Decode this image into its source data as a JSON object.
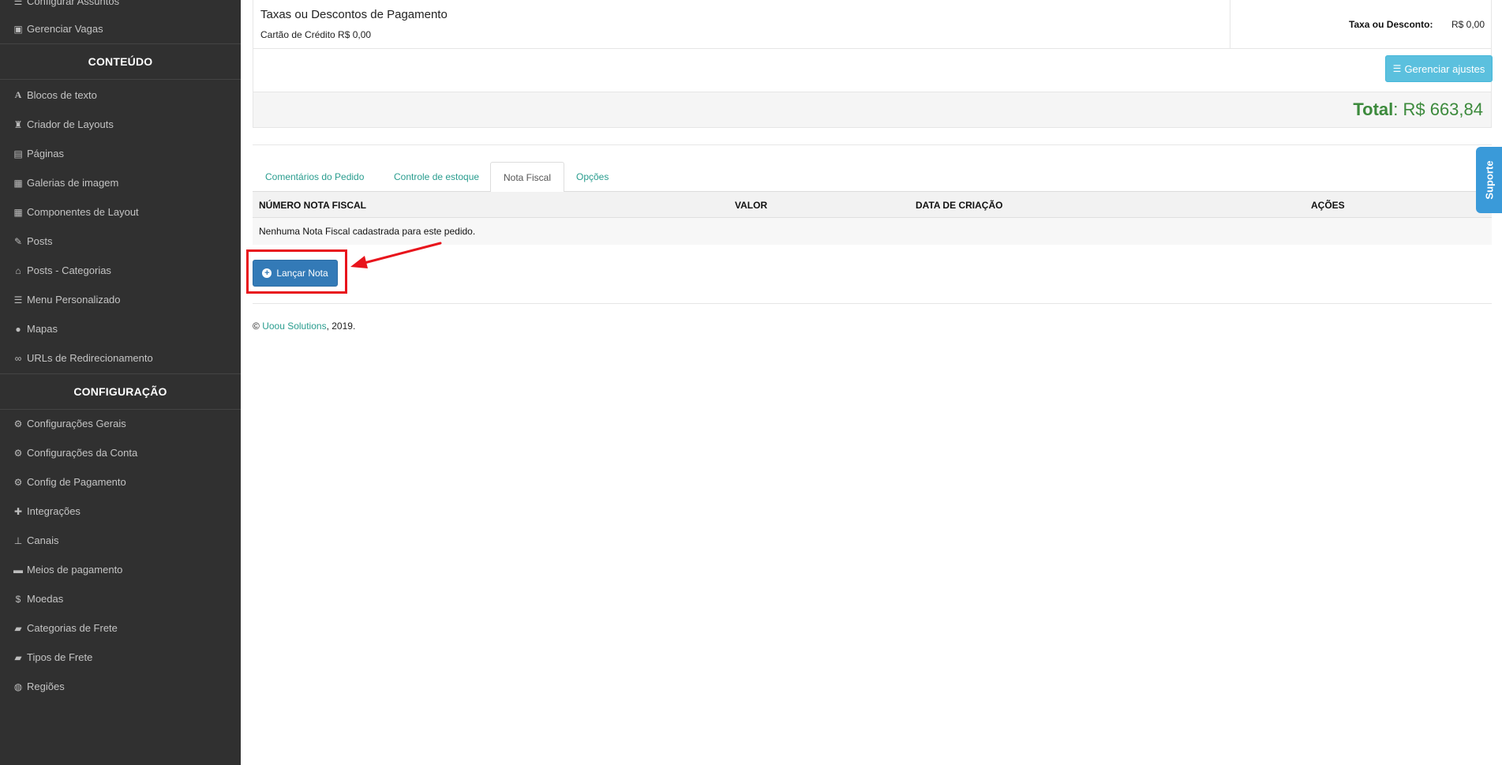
{
  "sidebar": {
    "top_items": [
      {
        "icon": "list-icon",
        "label": "Configurar Assuntos"
      },
      {
        "icon": "briefcase-icon",
        "label": "Gerenciar Vagas"
      }
    ],
    "sections": [
      {
        "heading": "CONTEÚDO",
        "items": [
          {
            "icon": "font-icon",
            "label": "Blocos de texto"
          },
          {
            "icon": "chess-rook-icon",
            "label": "Criador de Layouts"
          },
          {
            "icon": "file-icon",
            "label": "Páginas"
          },
          {
            "icon": "film-icon",
            "label": "Galerias de imagem"
          },
          {
            "icon": "th-large-icon",
            "label": "Componentes de Layout"
          },
          {
            "icon": "pin-icon",
            "label": "Posts"
          },
          {
            "icon": "home-icon",
            "label": "Posts - Categorias"
          },
          {
            "icon": "list-icon",
            "label": "Menu Personalizado"
          },
          {
            "icon": "map-marker-icon",
            "label": "Mapas"
          },
          {
            "icon": "link-icon",
            "label": "URLs de Redirecionamento"
          }
        ]
      },
      {
        "heading": "CONFIGURAÇÃO",
        "items": [
          {
            "icon": "gear-icon",
            "label": "Configurações Gerais"
          },
          {
            "icon": "gear-icon",
            "label": "Configurações da Conta"
          },
          {
            "icon": "gear-icon",
            "label": "Config de Pagamento"
          },
          {
            "icon": "puzzle-icon",
            "label": "Integrações"
          },
          {
            "icon": "sitemap-icon",
            "label": "Canais"
          },
          {
            "icon": "credit-card-icon",
            "label": "Meios de pagamento"
          },
          {
            "icon": "dollar-icon",
            "label": "Moedas"
          },
          {
            "icon": "truck-icon",
            "label": "Categorias de Frete"
          },
          {
            "icon": "truck-icon",
            "label": "Tipos de Frete"
          },
          {
            "icon": "globe-icon",
            "label": "Regiões"
          }
        ]
      }
    ]
  },
  "fees": {
    "title": "Taxas ou Descontos de Pagamento",
    "subtitle": "Cartão de Crédito R$ 0,00",
    "right_label": "Taxa ou Desconto:",
    "right_value": "R$ 0,00",
    "manage_button": "Gerenciar ajustes"
  },
  "total": {
    "label": "Total",
    "value": ": R$ 663,84"
  },
  "tabs": [
    {
      "label": "Comentários do Pedido",
      "active": false
    },
    {
      "label": "Controle de estoque",
      "active": false
    },
    {
      "label": "Nota Fiscal",
      "active": true
    },
    {
      "label": "Opções",
      "active": false
    }
  ],
  "invoice_table": {
    "columns": [
      "NÚMERO NOTA FISCAL",
      "VALOR",
      "DATA DE CRIAÇÃO",
      "AÇÕES"
    ],
    "empty_message": "Nenhuma Nota Fiscal cadastrada para este pedido."
  },
  "launch_button": "Lançar Nota",
  "footer": {
    "copyright": "©",
    "company": "Uoou Solutions",
    "year": ", 2019."
  },
  "support_tab": "Suporte",
  "colors": {
    "sidebar_bg": "#303030",
    "accent_teal": "#2a9d8f",
    "info_button": "#5bc0de",
    "primary_button": "#337ab7",
    "total_green": "#3c8a3c",
    "highlight_red": "#e8141c",
    "support_blue": "#3a9ad9"
  }
}
